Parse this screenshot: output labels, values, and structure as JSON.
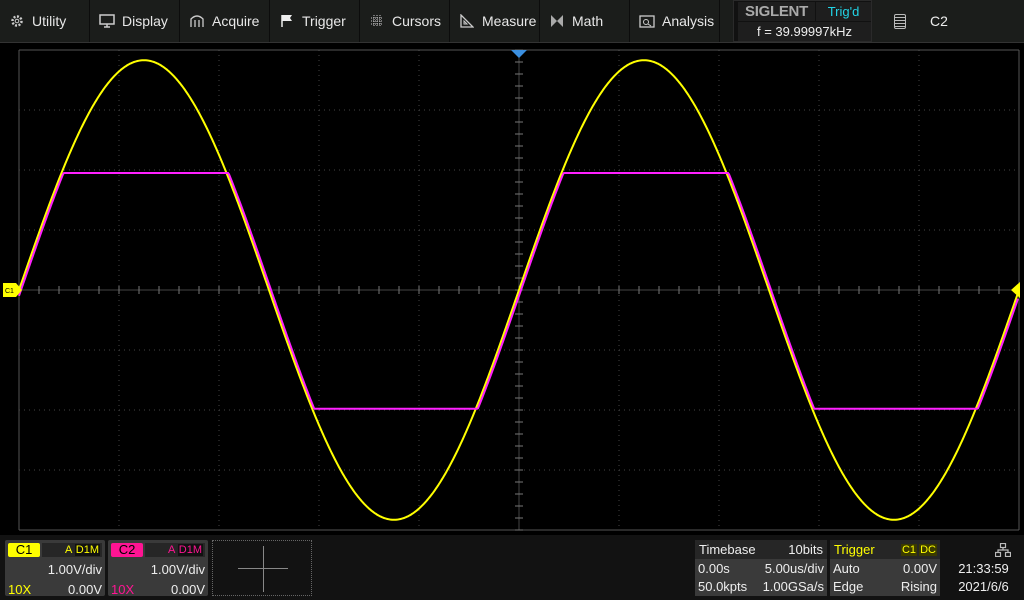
{
  "menu": [
    {
      "label": "Utility",
      "icon": "gear-icon"
    },
    {
      "label": "Display",
      "icon": "monitor-icon"
    },
    {
      "label": "Acquire",
      "icon": "acquire-icon"
    },
    {
      "label": "Trigger",
      "icon": "flag-icon"
    },
    {
      "label": "Cursors",
      "icon": "grid-icon"
    },
    {
      "label": "Measure",
      "icon": "ruler-triangle-icon"
    },
    {
      "label": "Math",
      "icon": "math-icon"
    },
    {
      "label": "Analysis",
      "icon": "analysis-icon"
    }
  ],
  "brand": {
    "logo": "SIGLENT",
    "trigger_status": "Trig'd",
    "frequency": "f = 39.99997kHz"
  },
  "active_channel": {
    "icon": "clipboard-icon",
    "label": "C2"
  },
  "channels": [
    {
      "name": "C1",
      "badge_a": "A",
      "badge_bw": "D1M",
      "vdiv": "1.00V/div",
      "probe": "10X",
      "offset": "0.00V",
      "color": "#ffff00"
    },
    {
      "name": "C2",
      "badge_a": "A",
      "badge_bw": "D1M",
      "vdiv": "1.00V/div",
      "probe": "10X",
      "offset": "0.00V",
      "color": "#ff1493"
    }
  ],
  "timebase": {
    "title": "Timebase",
    "bits": "10bits",
    "delay": "0.00s",
    "tdiv": "5.00us/div",
    "points": "50.0kpts",
    "rate": "1.00GSa/s"
  },
  "trigger": {
    "title": "Trigger",
    "source": "C1",
    "coupling": "DC",
    "mode": "Auto",
    "level": "0.00V",
    "type": "Edge",
    "slope": "Rising"
  },
  "clock": {
    "time": "21:33:59",
    "date": "2021/6/6",
    "icon": "network-icon"
  },
  "markers": {
    "c1_level": "C1"
  },
  "chart_data": {
    "type": "line",
    "x_unit": "us",
    "y_unit": "V",
    "xlim": [
      -25,
      25
    ],
    "ylim": [
      -4,
      4
    ],
    "x_divisions": 10,
    "y_divisions": 8,
    "grid": true,
    "series": [
      {
        "channel": "C1",
        "color": "#ffff00",
        "shape": "sine",
        "amplitude": 3.83,
        "frequency_khz": 40,
        "phase_zero_us": -25
      },
      {
        "channel": "C2",
        "color": "#ff20ff",
        "shape": "clipped-sine",
        "amplitude": 3.83,
        "clip_high": 1.95,
        "clip_low": -1.98,
        "frequency_khz": 40,
        "delay_us": 0.1
      }
    ]
  }
}
